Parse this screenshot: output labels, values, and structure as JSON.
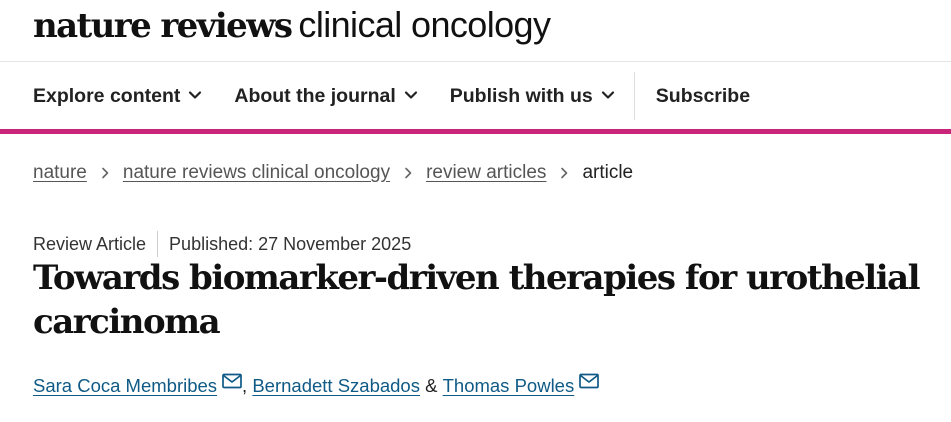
{
  "brand": {
    "bold": "nature reviews",
    "light": "clinical oncology"
  },
  "nav": {
    "items": [
      {
        "label": "Explore content"
      },
      {
        "label": "About the journal"
      },
      {
        "label": "Publish with us"
      }
    ],
    "subscribe": "Subscribe"
  },
  "breadcrumb": {
    "items": [
      "nature",
      "nature reviews clinical oncology",
      "review articles"
    ],
    "current": "article"
  },
  "article": {
    "type": "Review Article",
    "published": "Published: 27 November 2025",
    "title": "Towards biomarker-driven therapies for urothelial carcinoma",
    "authors": [
      "Sara Coca Membribes",
      "Bernadett Szabados",
      "Thomas Powles"
    ],
    "separators": [
      ", ",
      " & "
    ]
  },
  "colors": {
    "accent": "#c9257a",
    "link": "#0f5a86",
    "breadcrumb_link": "#555555",
    "text": "#222222"
  },
  "icons": {
    "nav_dropdown": "chevron-down-icon",
    "breadcrumb_separator": "chevron-right-icon",
    "author_contact": "mail-icon"
  }
}
